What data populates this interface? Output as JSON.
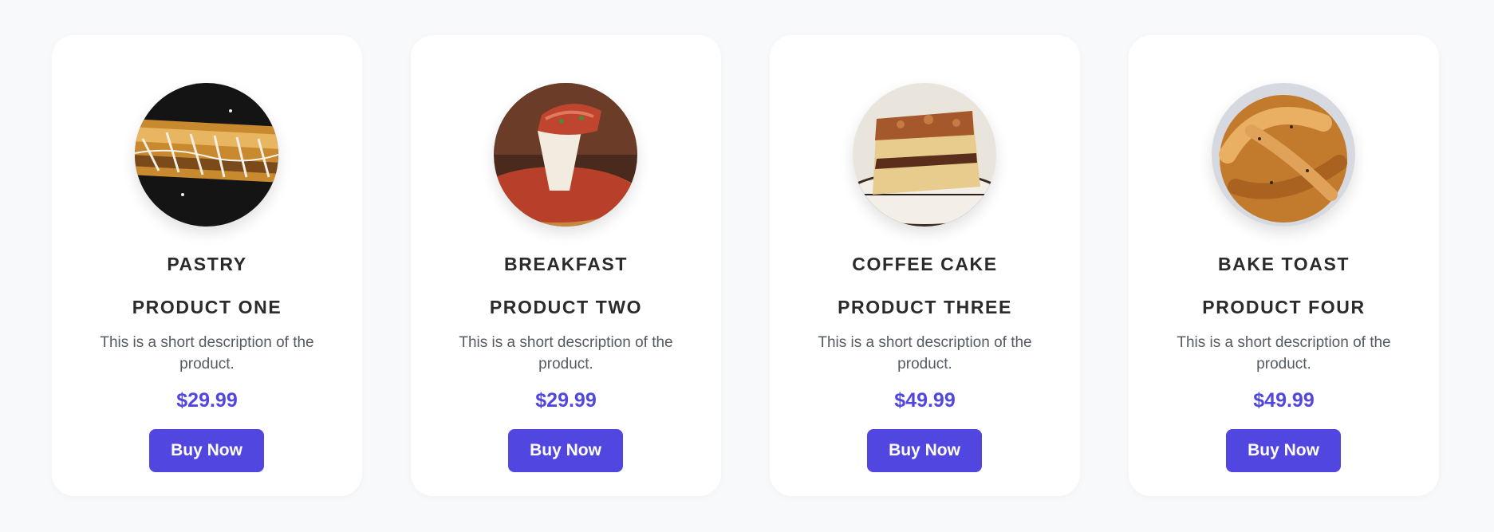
{
  "products": [
    {
      "category": "PASTRY",
      "name": "PRODUCT ONE",
      "description": "This is a short description of the product.",
      "price": "$29.99",
      "button_label": "Buy Now",
      "image_icon": "pastry-photo"
    },
    {
      "category": "BREAKFAST",
      "name": "PRODUCT TWO",
      "description": "This is a short description of the product.",
      "price": "$29.99",
      "button_label": "Buy Now",
      "image_icon": "deep-dish-pizza-photo"
    },
    {
      "category": "COFFEE CAKE",
      "name": "PRODUCT THREE",
      "description": "This is a short description of the product.",
      "price": "$49.99",
      "button_label": "Buy Now",
      "image_icon": "coffee-cake-photo"
    },
    {
      "category": "BAKE TOAST",
      "name": "PRODUCT FOUR",
      "description": "This is a short description of the product.",
      "price": "$49.99",
      "button_label": "Buy Now",
      "image_icon": "sweet-bread-photo"
    }
  ],
  "colors": {
    "accent": "#5146e0",
    "page_background": "#f8f9fb",
    "card_background": "#ffffff",
    "heading_text": "#2b2b2b",
    "body_text": "#555b63"
  }
}
